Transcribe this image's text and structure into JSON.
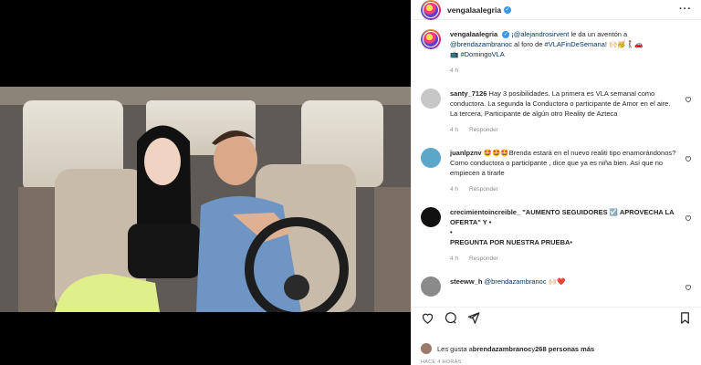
{
  "post": {
    "username": "vengalaalegria",
    "verified_icon": "verified-badge-icon",
    "caption_mention_1": "¡@alejandrosirvent",
    "caption_text_1": " le da un aventón a ",
    "caption_mention_2": "@brendazambranoc",
    "caption_text_2": " al foro de ",
    "caption_tag_1": "#VLAFinDeSemana",
    "caption_text_3": "! 🙌🏻🥳🚶‍♀️🚗",
    "caption_text_4": "📺 ",
    "caption_tag_2": "#DomingoVLA",
    "caption_time": "4 h"
  },
  "comments": [
    {
      "user": "santy_7126",
      "text": "Hay 3 posibilidades. La primera es VLA semanal como conductora. La segunda la Conductora o participante de Amor en el aire. La tercera, Participante de algún otro Reality de Azteca",
      "time": "4 h",
      "reply": "Responder",
      "avatar_color": "#c7c7c7"
    },
    {
      "user": "juanlpznv",
      "text": "🤩🤩🤩Brenda estará en el nuevo realiti tipo enamorándonos? Como conductora o participante , dice que ya es niña bien. Así que no empiecen a tirarle",
      "time": "4 h",
      "reply": "Responder",
      "avatar_color": "#5ba6c9"
    },
    {
      "user": "crecimientoincreible_",
      "text": "\"AUMENTO SEGUIDORES ☑️ APROVECHA LA OFERTA\" Y •",
      "text2": "•",
      "text3": "PREGUNTA POR NUESTRA PRUEBA•",
      "time": "4 h",
      "reply": "Responder",
      "avatar_color": "#111111"
    },
    {
      "user": "steeww_h",
      "mention": "@brendazambranoc",
      "text": " 🙌🏻❤️",
      "avatar_color": "#8a8a8a"
    }
  ],
  "footer": {
    "likes_prefix": "Les gusta a ",
    "likes_user": "brendazambranoc",
    "likes_and": " y ",
    "likes_count": "268 personas más",
    "ago": "HACE 4 HORAS"
  }
}
